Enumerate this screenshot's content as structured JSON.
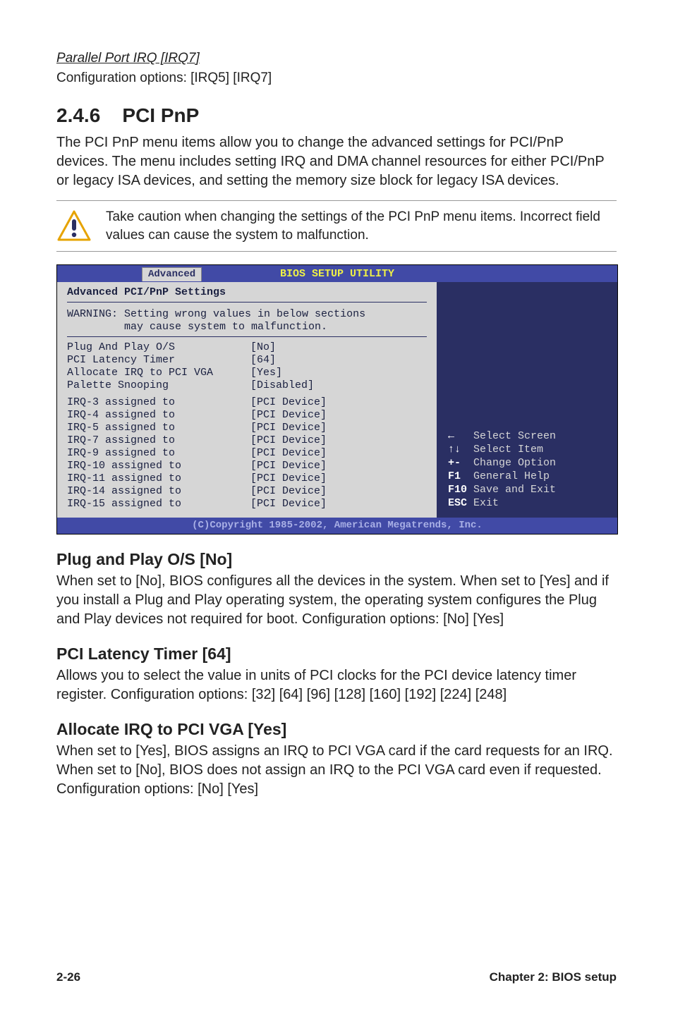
{
  "parallel": {
    "title": "Parallel Port IRQ [IRQ7]",
    "options": "Configuration options: [IRQ5] [IRQ7]"
  },
  "section": {
    "number": "2.4.6",
    "title": "PCI PnP",
    "desc": "The PCI PnP menu items allow you to change the advanced settings for PCI/PnP devices. The menu includes setting IRQ and DMA channel resources for either PCI/PnP or legacy ISA devices, and setting the memory size block for legacy ISA devices."
  },
  "note": "Take caution when changing the settings of the PCI PnP menu items. Incorrect field values can cause the system to malfunction.",
  "bios": {
    "title": "BIOS SETUP UTILITY",
    "tab": "Advanced",
    "panel_title": "Advanced PCI/PnP Settings",
    "warning": "WARNING: Setting wrong values in below sections\n         may cause system to malfunction.",
    "settings": [
      {
        "k": "Plug And Play O/S",
        "v": "[No]"
      },
      {
        "k": "PCI Latency Timer",
        "v": "[64]"
      },
      {
        "k": "Allocate IRQ to PCI VGA",
        "v": "[Yes]"
      },
      {
        "k": "Palette Snooping",
        "v": "[Disabled]"
      }
    ],
    "irqs": [
      {
        "k": "IRQ-3 assigned to",
        "v": "[PCI Device]"
      },
      {
        "k": "IRQ-4 assigned to",
        "v": "[PCI Device]"
      },
      {
        "k": "IRQ-5 assigned to",
        "v": "[PCI Device]"
      },
      {
        "k": "IRQ-7 assigned to",
        "v": "[PCI Device]"
      },
      {
        "k": "IRQ-9 assigned to",
        "v": "[PCI Device]"
      },
      {
        "k": "IRQ-10 assigned to",
        "v": "[PCI Device]"
      },
      {
        "k": "IRQ-11 assigned to",
        "v": "[PCI Device]"
      },
      {
        "k": "IRQ-14 assigned to",
        "v": "[PCI Device]"
      },
      {
        "k": "IRQ-15 assigned to",
        "v": "[PCI Device]"
      }
    ],
    "help": [
      {
        "key": "←",
        "label": "Select Screen"
      },
      {
        "key": "↑↓",
        "label": "Select Item"
      },
      {
        "key": "+-",
        "label": "Change Option"
      },
      {
        "key": "F1",
        "label": "General Help"
      },
      {
        "key": "F10",
        "label": "Save and Exit"
      },
      {
        "key": "ESC",
        "label": "Exit"
      }
    ],
    "footer": "(C)Copyright 1985-2002, American Megatrends, Inc."
  },
  "plug_play": {
    "title": "Plug and Play O/S [No]",
    "desc": "When set to [No], BIOS configures all the devices in the system. When set to [Yes] and if you install a Plug and Play operating system, the operating system configures the Plug and Play devices not required for boot. Configuration options: [No] [Yes]"
  },
  "latency": {
    "title": "PCI Latency Timer [64]",
    "desc": "Allows you to select the value in units of PCI clocks for the PCI device latency timer register. Configuration options: [32] [64] [96] [128] [160] [192] [224] [248]"
  },
  "allocate": {
    "title": "Allocate IRQ to PCI VGA [Yes]",
    "desc": "When set to [Yes], BIOS assigns an IRQ to PCI VGA card if the card requests for an IRQ. When set to [No], BIOS does not assign an IRQ to the PCI VGA card even if requested. Configuration options: [No] [Yes]"
  },
  "footer": {
    "left": "2-26",
    "right": "Chapter 2: BIOS setup"
  }
}
